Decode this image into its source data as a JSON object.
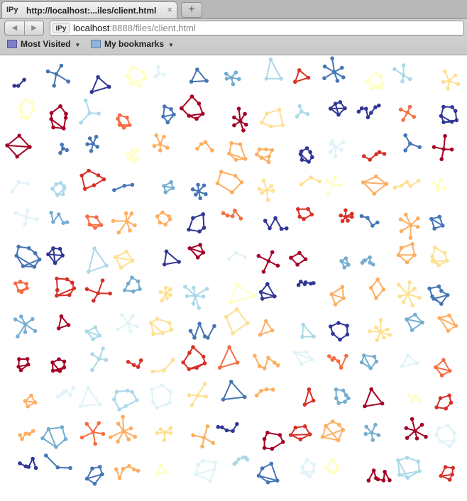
{
  "browser": {
    "tab": {
      "favicon": "IPy",
      "title": "http://localhost:...iles/client.html",
      "close_glyph": "×"
    },
    "new_tab_glyph": "+",
    "nav": {
      "back_glyph": "◀",
      "forward_glyph": "▶"
    },
    "url": {
      "favicon": "IPy",
      "host": "localhost",
      "rest": ":8888/files/client.html"
    },
    "bookmarks": [
      {
        "label": "Most Visited",
        "icon": "most-visited-icon",
        "dropdown": "▼"
      },
      {
        "label": "My bookmarks",
        "icon": "folder-icon",
        "dropdown": "▼"
      }
    ]
  },
  "palette": [
    "#a50026",
    "#d73027",
    "#f46d43",
    "#fdae61",
    "#fee090",
    "#ffffbf",
    "#e0f3f8",
    "#abd9e9",
    "#74add1",
    "#4575b4",
    "#313695"
  ],
  "graph": {
    "component_count": 160
  }
}
